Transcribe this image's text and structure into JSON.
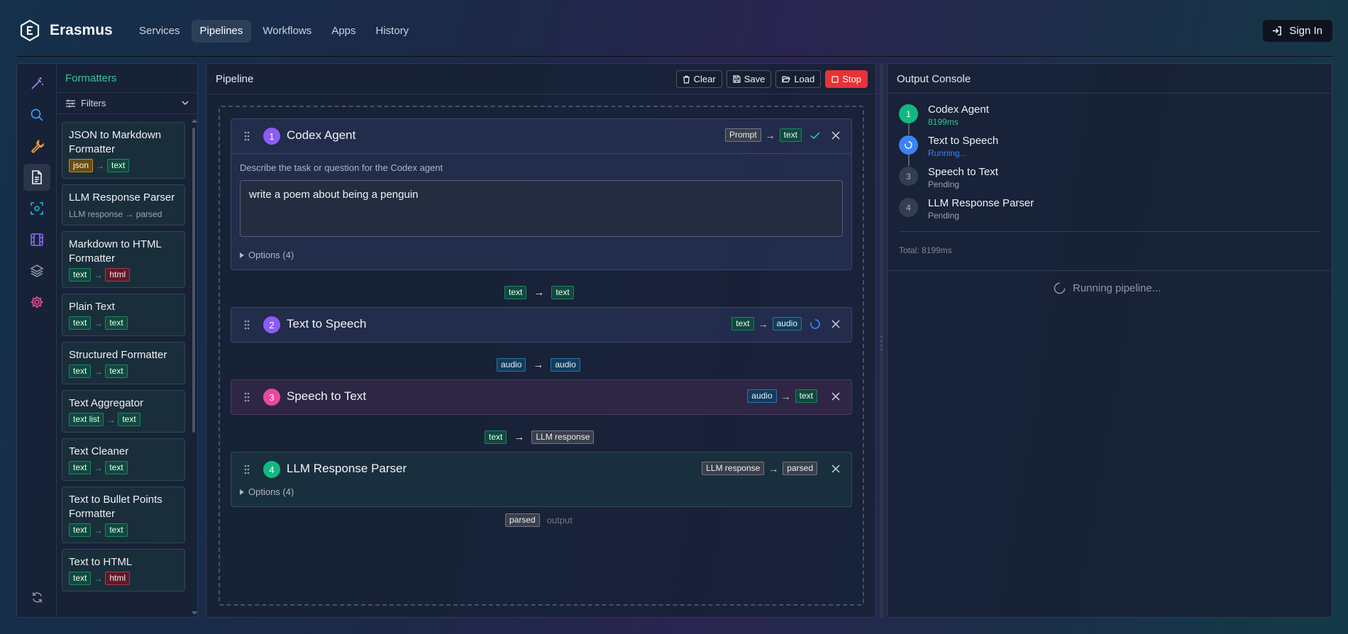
{
  "header": {
    "brand": "Erasmus",
    "nav": [
      {
        "label": "Services",
        "active": false
      },
      {
        "label": "Pipelines",
        "active": true
      },
      {
        "label": "Workflows",
        "active": false
      },
      {
        "label": "Apps",
        "active": false
      },
      {
        "label": "History",
        "active": false
      }
    ],
    "sign_in": "Sign In"
  },
  "sidebar": {
    "rail_icons": [
      "magic-wand-icon",
      "search-icon",
      "wrench-icon",
      "document-icon",
      "scan-icon",
      "film-icon",
      "layers-icon",
      "gear-icon",
      "refresh-icon"
    ],
    "section_title": "Formatters",
    "filters_label": "Filters",
    "formatters": [
      {
        "name": "JSON to Markdown Formatter",
        "in": "json",
        "out": "text"
      },
      {
        "name": "LLM Response Parser",
        "io_text": "LLM response → parsed"
      },
      {
        "name": "Markdown to HTML Formatter",
        "in": "text",
        "out": "html"
      },
      {
        "name": "Plain Text",
        "in": "text",
        "out": "text"
      },
      {
        "name": "Structured Formatter",
        "in": "text",
        "out": "text"
      },
      {
        "name": "Text Aggregator",
        "in": "text list",
        "out": "text"
      },
      {
        "name": "Text Cleaner",
        "in": "text",
        "out": "text"
      },
      {
        "name": "Text to Bullet Points Formatter",
        "in": "text",
        "out": "text"
      },
      {
        "name": "Text to HTML",
        "in": "text",
        "out": "html"
      }
    ]
  },
  "pipeline": {
    "title": "Pipeline",
    "buttons": {
      "clear": "Clear",
      "save": "Save",
      "load": "Load",
      "stop": "Stop"
    },
    "steps": [
      {
        "num": "1",
        "name": "Codex Agent",
        "in": "Prompt",
        "out": "text",
        "color": "#8b5cf6",
        "description": "Describe the task or question for the Codex agent",
        "prompt": "write a poem about being a penguin",
        "options": "Options (4)"
      },
      {
        "num": "2",
        "name": "Text to Speech",
        "in": "text",
        "out": "audio",
        "color": "#8b5cf6"
      },
      {
        "num": "3",
        "name": "Speech to Text",
        "in": "audio",
        "out": "text",
        "color": "#ec4899"
      },
      {
        "num": "4",
        "name": "LLM Response Parser",
        "in": "LLM response",
        "out": "parsed",
        "color": "#10b981",
        "options": "Options (4)"
      }
    ],
    "connectors": [
      {
        "from": "text",
        "to": "text"
      },
      {
        "from": "audio",
        "to": "audio"
      },
      {
        "from": "text",
        "to": "LLM response"
      }
    ],
    "final_output": {
      "type": "parsed",
      "label": "output"
    }
  },
  "console": {
    "title": "Output Console",
    "steps": [
      {
        "num": "1",
        "name": "Codex Agent",
        "status": "8199ms",
        "state": "done"
      },
      {
        "num": "2",
        "name": "Text to Speech",
        "status": "Running...",
        "state": "running"
      },
      {
        "num": "3",
        "name": "Speech to Text",
        "status": "Pending",
        "state": "pending"
      },
      {
        "num": "4",
        "name": "LLM Response Parser",
        "status": "Pending",
        "state": "pending"
      }
    ],
    "total": "Total: 8199ms",
    "running_msg": "Running pipeline..."
  }
}
